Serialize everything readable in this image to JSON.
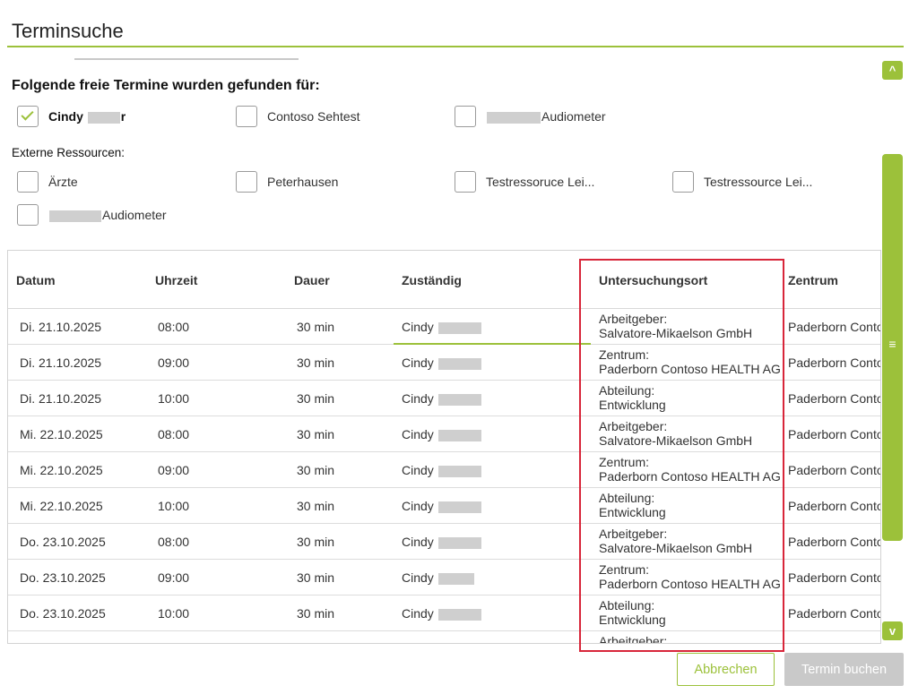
{
  "header": {
    "title": "Terminsuche"
  },
  "found": {
    "heading": "Folgende freie Termine wurden gefunden für:",
    "items": [
      {
        "label_prefix": "Cindy",
        "label_suffix": "r",
        "checked": true
      },
      {
        "label": "Contoso Sehtest",
        "checked": false
      },
      {
        "label": "Audiometer",
        "checked": false
      }
    ]
  },
  "external": {
    "heading": "Externe Ressourcen:",
    "items": [
      {
        "label": "Ärzte",
        "checked": false
      },
      {
        "label": "Peterhausen",
        "checked": false
      },
      {
        "label": "Testressoruce Lei...",
        "checked": false
      },
      {
        "label": "Testressource Lei...",
        "checked": false
      },
      {
        "label": "Audiometer",
        "checked": false
      }
    ]
  },
  "table": {
    "columns": [
      "Datum",
      "Uhrzeit",
      "Dauer",
      "Zuständig",
      "Untersuchungsort",
      "Zentrum"
    ],
    "rows": [
      {
        "datum": "Di. 21.10.2025",
        "uhrzeit": "08:00",
        "dauer": "30 min",
        "zustaendig": "Cindy",
        "ort1": "Arbeitgeber:",
        "ort2": "Salvatore-Mikaelson GmbH",
        "zentrum": "Paderborn Contoso"
      },
      {
        "datum": "Di. 21.10.2025",
        "uhrzeit": "09:00",
        "dauer": "30 min",
        "zustaendig": "Cindy",
        "ort1": "Zentrum:",
        "ort2": "Paderborn Contoso HEALTH AG",
        "zentrum": "Paderborn Contoso"
      },
      {
        "datum": "Di. 21.10.2025",
        "uhrzeit": "10:00",
        "dauer": "30 min",
        "zustaendig": "Cindy",
        "ort1": "Abteilung:",
        "ort2": "Entwicklung",
        "zentrum": "Paderborn Contoso"
      },
      {
        "datum": "Mi. 22.10.2025",
        "uhrzeit": "08:00",
        "dauer": "30 min",
        "zustaendig": "Cindy",
        "ort1": "Arbeitgeber:",
        "ort2": "Salvatore-Mikaelson GmbH",
        "zentrum": "Paderborn Contoso"
      },
      {
        "datum": "Mi. 22.10.2025",
        "uhrzeit": "09:00",
        "dauer": "30 min",
        "zustaendig": "Cindy",
        "ort1": "Zentrum:",
        "ort2": "Paderborn Contoso HEALTH AG",
        "zentrum": "Paderborn Contoso"
      },
      {
        "datum": "Mi. 22.10.2025",
        "uhrzeit": "10:00",
        "dauer": "30 min",
        "zustaendig": "Cindy",
        "ort1": "Abteilung:",
        "ort2": "Entwicklung",
        "zentrum": "Paderborn Contoso"
      },
      {
        "datum": "Do. 23.10.2025",
        "uhrzeit": "08:00",
        "dauer": "30 min",
        "zustaendig": "Cindy",
        "ort1": "Arbeitgeber:",
        "ort2": "Salvatore-Mikaelson GmbH",
        "zentrum": "Paderborn Contoso"
      },
      {
        "datum": "Do. 23.10.2025",
        "uhrzeit": "09:00",
        "dauer": "30 min",
        "zustaendig": "Cindy",
        "ort1": "Zentrum:",
        "ort2": "Paderborn Contoso HEALTH AG",
        "zentrum": "Paderborn Contoso"
      },
      {
        "datum": "Do. 23.10.2025",
        "uhrzeit": "10:00",
        "dauer": "30 min",
        "zustaendig": "Cindy",
        "ort1": "Abteilung:",
        "ort2": "Entwicklung",
        "zentrum": "Paderborn Contoso"
      },
      {
        "datum": "",
        "uhrzeit": "",
        "dauer": "",
        "zustaendig": "",
        "ort1": "Arbeitgeber:",
        "ort2": "",
        "zentrum": ""
      }
    ]
  },
  "scroll": {
    "up_icon": "^",
    "down_icon": "v",
    "grip_icon": "≡"
  },
  "buttons": {
    "cancel": "Abbrechen",
    "book": "Termin buchen"
  },
  "colors": {
    "accent": "#9cc13a",
    "highlight": "#d8263a",
    "disabled": "#c9c9c9"
  }
}
